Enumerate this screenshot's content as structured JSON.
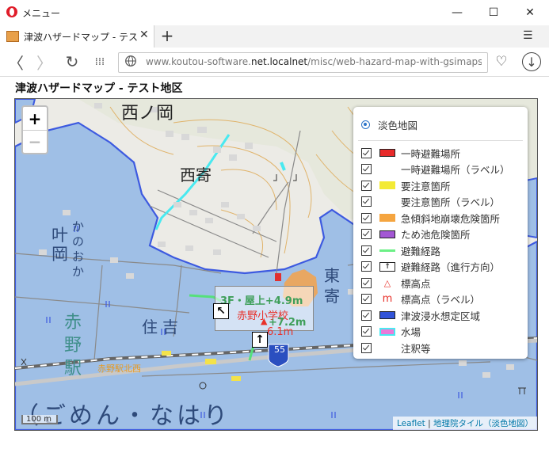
{
  "window": {
    "title": "メニュー",
    "minimize_label": "—",
    "maximize_label": "☐",
    "close_label": "✕"
  },
  "tab": {
    "title": "津波ハザードマップ - テスト地区",
    "close_label": "✕",
    "new_tab_label": "+",
    "menu_label": "☰"
  },
  "nav": {
    "back_label": "〈",
    "forward_label": "〉",
    "reload_label": "↻",
    "speed_dial_label": "⁞⁞⁞",
    "url_prefix": "www.koutou-software.",
    "url_domain": "net.localnet",
    "url_path": "/misc/web-hazard-map-with-gsimaps-a",
    "heart_label": "♡",
    "download_label": "↓"
  },
  "page": {
    "heading": "津波ハザードマップ - テスト地区"
  },
  "map": {
    "zoom_in": "+",
    "zoom_out": "−",
    "scale_label": "100 m",
    "attribution_leaflet": "Leaflet",
    "attribution_sep": " | ",
    "attribution_gsi": "地理院タイル（淡色地図）",
    "place_labels": {
      "nishinooka": "西ノ岡",
      "nishiyose": "西寄",
      "kanooka_kanji": "叶岡",
      "kanooka_kana": "かのおか",
      "sumiyoshi": "住吉",
      "akano_eki": "赤野駅",
      "higashiyose": "東寄",
      "gomen": "（ごめん・なはり",
      "station_name_orange": "赤野駅北西",
      "route_number": "55"
    },
    "popup": {
      "school_label": "赤野小学校",
      "elev_1": "3F・屋上+4.9m",
      "elev_2": "+7.2m",
      "elev_3": "6.1m",
      "arrow_1": "↖",
      "arrow_2": "↑"
    },
    "colors": {
      "inundation": "#9fbfe6",
      "inundation_border": "#3d5ae0",
      "route": "#55e07a",
      "water": "#49e9f0",
      "caution": "#f4a24a"
    }
  },
  "layers": {
    "base": "淡色地図",
    "overlays": [
      {
        "label": "一時避難場所",
        "icon": "red-rect-icon"
      },
      {
        "label": "一時避難場所（ラベル）",
        "icon": "none"
      },
      {
        "label": "要注意箇所",
        "icon": "yellow-rect-icon"
      },
      {
        "label": "要注意箇所（ラベル）",
        "icon": "none"
      },
      {
        "label": "急傾斜地崩壊危険箇所",
        "icon": "orange-rect-icon"
      },
      {
        "label": "ため池危険箇所",
        "icon": "purple-rect-icon"
      },
      {
        "label": "避難経路",
        "icon": "green-line-icon"
      },
      {
        "label": "避難経路（進行方向）",
        "icon": "up-arrow-box-icon"
      },
      {
        "label": "標高点",
        "icon": "red-triangle-icon"
      },
      {
        "label": "標高点（ラベル）",
        "icon": "red-m-icon"
      },
      {
        "label": "津波浸水想定区域",
        "icon": "blue-rect-icon"
      },
      {
        "label": "水場",
        "icon": "cyan-rect-icon"
      },
      {
        "label": "注釈等",
        "icon": "none"
      }
    ]
  }
}
